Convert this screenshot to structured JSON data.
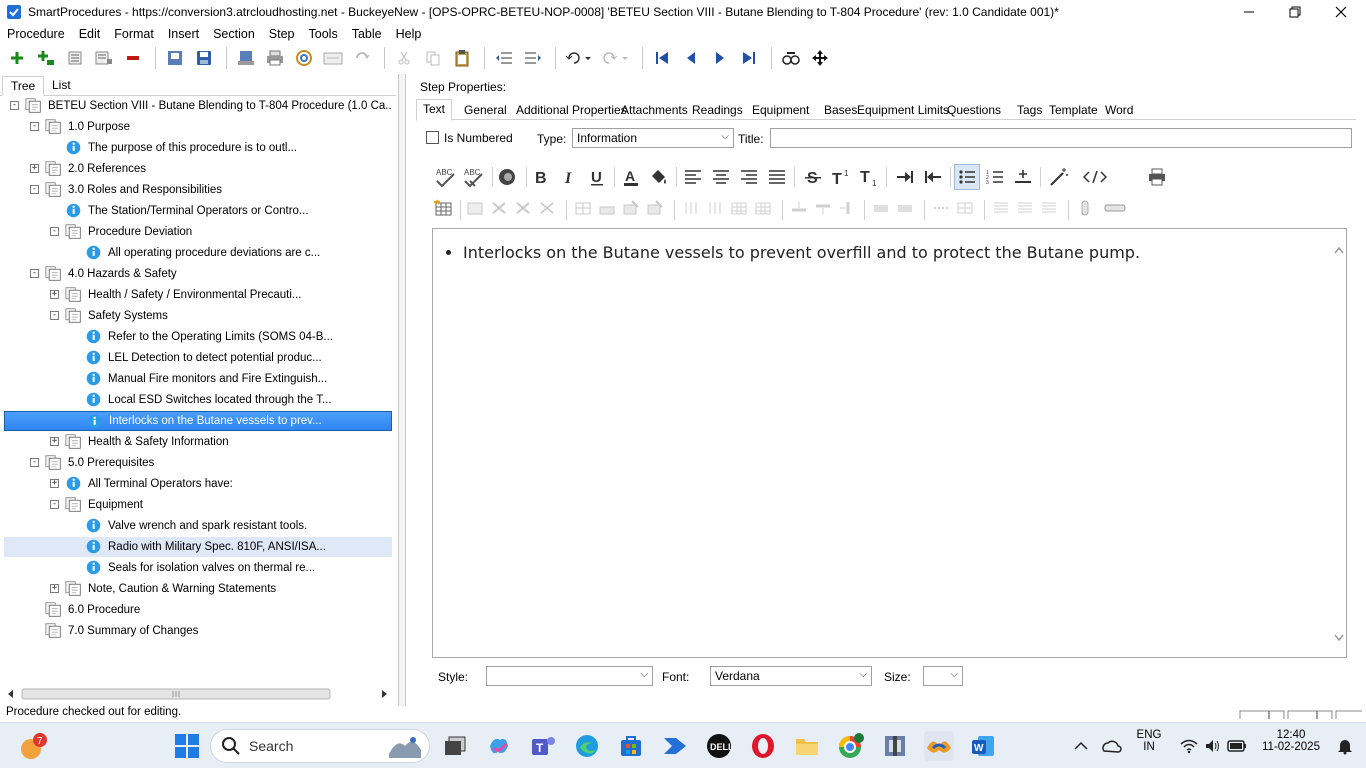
{
  "window": {
    "title": "SmartProcedures - https://conversion3.atrcloudhosting.net - BuckeyeNew - [OPS-OPRC-BETEU-NOP-0008] 'BETEU Section VIII - Butane Blending to T-804 Procedure' (rev: 1.0 Candidate 001)*"
  },
  "menu": [
    "Procedure",
    "Edit",
    "Format",
    "Insert",
    "Section",
    "Step",
    "Tools",
    "Table",
    "Help"
  ],
  "left_tabs": [
    "Tree",
    "List"
  ],
  "tree": [
    {
      "label": "BETEU Section VIII - Butane Blending to T-804 Procedure (1.0 Ca...",
      "depth": 0,
      "expander": "−",
      "icon": "section-icon"
    },
    {
      "label": "1.0 Purpose",
      "depth": 1,
      "expander": "−",
      "icon": "section-icon"
    },
    {
      "label": "The purpose of this procedure is to outl...",
      "depth": 2,
      "expander": "",
      "icon": "info-icon"
    },
    {
      "label": "2.0 References",
      "depth": 1,
      "expander": "+",
      "icon": "section-icon"
    },
    {
      "label": "3.0 Roles and Responsibilities",
      "depth": 1,
      "expander": "−",
      "icon": "section-icon"
    },
    {
      "label": "The Station/Terminal Operators or Contro...",
      "depth": 2,
      "expander": "",
      "icon": "info-icon"
    },
    {
      "label": "Procedure Deviation",
      "depth": 2,
      "expander": "−",
      "icon": "section-icon"
    },
    {
      "label": "All operating procedure deviations are c...",
      "depth": 3,
      "expander": "",
      "icon": "info-icon"
    },
    {
      "label": "4.0 Hazards & Safety",
      "depth": 1,
      "expander": "−",
      "icon": "section-icon"
    },
    {
      "label": "Health / Safety / Environmental Precauti...",
      "depth": 2,
      "expander": "+",
      "icon": "section-icon"
    },
    {
      "label": "Safety Systems",
      "depth": 2,
      "expander": "−",
      "icon": "section-icon"
    },
    {
      "label": "Refer to the Operating Limits (SOMS 04-B...",
      "depth": 3,
      "expander": "",
      "icon": "info-icon"
    },
    {
      "label": "LEL Detection to detect potential produc...",
      "depth": 3,
      "expander": "",
      "icon": "info-icon"
    },
    {
      "label": "Manual Fire monitors and Fire Extinguish...",
      "depth": 3,
      "expander": "",
      "icon": "info-icon"
    },
    {
      "label": "Local ESD Switches located through the T...",
      "depth": 3,
      "expander": "",
      "icon": "info-icon"
    },
    {
      "label": "Interlocks on the Butane vessels to prev...",
      "depth": 3,
      "expander": "",
      "icon": "info-icon",
      "selected": true
    },
    {
      "label": "Health & Safety Information",
      "depth": 2,
      "expander": "+",
      "icon": "section-icon"
    },
    {
      "label": "5.0 Prerequisites",
      "depth": 1,
      "expander": "−",
      "icon": "section-icon"
    },
    {
      "label": "All Terminal Operators have:",
      "depth": 2,
      "expander": "+",
      "icon": "info-icon"
    },
    {
      "label": "Equipment",
      "depth": 2,
      "expander": "−",
      "icon": "section-icon"
    },
    {
      "label": "Valve wrench and spark resistant tools.",
      "depth": 3,
      "expander": "",
      "icon": "info-icon"
    },
    {
      "label": "Radio with Military Spec. 810F, ANSI/ISA...",
      "depth": 3,
      "expander": "",
      "icon": "info-icon",
      "hover": true
    },
    {
      "label": "Seals for isolation valves on thermal re...",
      "depth": 3,
      "expander": "",
      "icon": "info-icon"
    },
    {
      "label": "Note, Caution & Warning Statements",
      "depth": 2,
      "expander": "+",
      "icon": "section-icon"
    },
    {
      "label": "6.0 Procedure",
      "depth": 1,
      "expander": "",
      "icon": "section-icon"
    },
    {
      "label": "7.0 Summary of Changes",
      "depth": 1,
      "expander": "",
      "icon": "section-icon"
    }
  ],
  "step_properties": {
    "heading": "Step Properties:",
    "tabs": [
      "Text",
      "General",
      "Additional Properties",
      "Attachments",
      "Readings",
      "Equipment",
      "Bases",
      "Equipment Limits",
      "Questions",
      "Tags",
      "Template",
      "Word"
    ],
    "active_tab": "Text",
    "is_numbered_label": "Is Numbered",
    "type_label": "Type:",
    "type_value": "Information",
    "title_label": "Title:",
    "title_value": "",
    "editor_text": "Interlocks on the Butane vessels to prevent overfill and to protect the Butane pump.",
    "style_label": "Style:",
    "style_value": "",
    "font_label": "Font:",
    "font_value": "Verdana",
    "size_label": "Size:",
    "size_value": ""
  },
  "status": {
    "message": "Procedure checked out for editing."
  },
  "taskbar": {
    "search_placeholder": "Search",
    "notification_count": "7",
    "lang_top": "ENG",
    "lang_bottom": "IN",
    "time": "12:40",
    "date": "11-02-2025"
  },
  "colors": {
    "selected_row": "#3a8cf3",
    "hover_row": "#dfe8f7",
    "info_icon": "#2a9be6",
    "taskbar_bg": "#e8eef6"
  }
}
